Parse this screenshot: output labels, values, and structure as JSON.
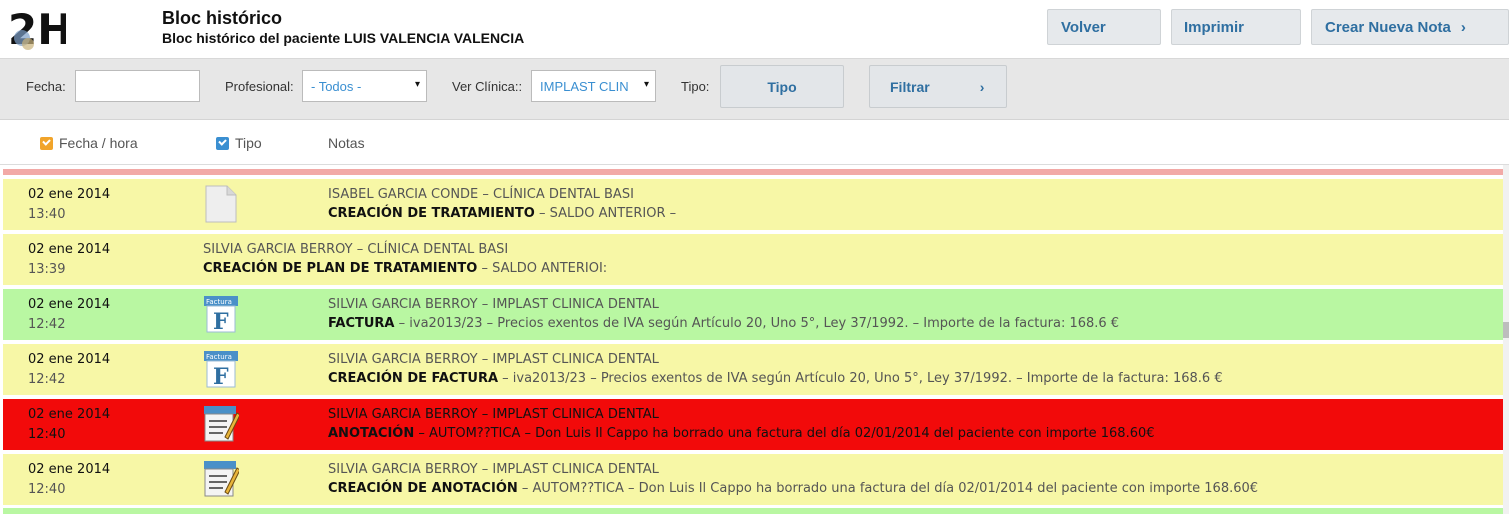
{
  "header": {
    "logo_alt": "2H",
    "title": "Bloc histórico",
    "subtitle": "Bloc histórico del paciente LUIS VALENCIA VALENCIA",
    "buttons": {
      "back": "Volver",
      "print": "Imprimir",
      "new_note": "Crear Nueva Nota",
      "new_note_icon": "›"
    }
  },
  "filters": {
    "date_label": "Fecha:",
    "date_value": "",
    "professional_label": "Profesional:",
    "professional_value": "- Todos -",
    "clinic_label": "Ver Clínica::",
    "clinic_value": "IMPLAST CLIN",
    "type_label": "Tipo:",
    "type_button": "Tipo",
    "filter_button": "Filtrar",
    "filter_icon": "›",
    "dropdown_arrow": "▾"
  },
  "columns": {
    "datetime": "Fecha / hora",
    "type": "Tipo",
    "notes": "Notas"
  },
  "colors": {
    "yellow_row": "#f7f7a6",
    "green_row": "#b9f7a2",
    "red_row": "#f20a0a",
    "accent": "#2f6fa1",
    "checkbox_orange": "#f1a42a",
    "checkbox_blue": "#3a8fd1",
    "separator": "#f2a9a6"
  },
  "rows": [
    {
      "date": "02 ene 2014",
      "time": "13:40",
      "icon": "blank-document-icon",
      "line1": "ISABEL GARCIA CONDE – CLÍNICA DENTAL BASI",
      "action": "CREACIÓN DE TRATAMIENTO",
      "detail": " – SALDO ANTERIOR –",
      "color": "yellow"
    },
    {
      "date": "02 ene 2014",
      "time": "13:39",
      "icon": "",
      "line1": "SILVIA GARCIA BERROY – CLÍNICA DENTAL BASI",
      "action": "CREACIÓN DE PLAN DE TRATAMIENTO",
      "detail": " – SALDO ANTERIOI:",
      "color": "yellow"
    },
    {
      "date": "02 ene 2014",
      "time": "12:42",
      "icon": "invoice-icon",
      "icon_label": "Factura",
      "icon_letter": "F",
      "line1": "SILVIA GARCIA BERROY – IMPLAST CLINICA DENTAL",
      "action": "FACTURA",
      "detail": " – iva2013/23 – Precios exentos de IVA según Artículo 20, Uno 5°, Ley 37/1992. – Importe de la factura: 168.6 €",
      "color": "green"
    },
    {
      "date": "02 ene 2014",
      "time": "12:42",
      "icon": "invoice-icon",
      "icon_label": "Factura",
      "icon_letter": "F",
      "line1": "SILVIA GARCIA BERROY – IMPLAST CLINICA DENTAL",
      "action": "CREACIÓN DE FACTURA",
      "detail": " – iva2013/23 – Precios exentos de IVA según Artículo 20, Uno 5°, Ley 37/1992. – Importe de la factura: 168.6 €",
      "color": "yellow"
    },
    {
      "date": "02 ene 2014",
      "time": "12:40",
      "icon": "annotation-icon",
      "line1": "SILVIA GARCIA BERROY – IMPLAST CLINICA DENTAL",
      "action": "ANOTACIÓN",
      "detail": " – AUTOM??TICA – Don Luis Il Cappo ha borrado una factura del día 02/01/2014 del paciente con importe 168.60€",
      "color": "red"
    },
    {
      "date": "02 ene 2014",
      "time": "12:40",
      "icon": "annotation-icon",
      "line1": "SILVIA GARCIA BERROY – IMPLAST CLINICA DENTAL",
      "action": "CREACIÓN DE ANOTACIÓN",
      "detail": " – AUTOM??TICA – Don Luis Il Cappo ha borrado una factura del día 02/01/2014 del paciente con importe 168.60€",
      "color": "yellow"
    }
  ]
}
